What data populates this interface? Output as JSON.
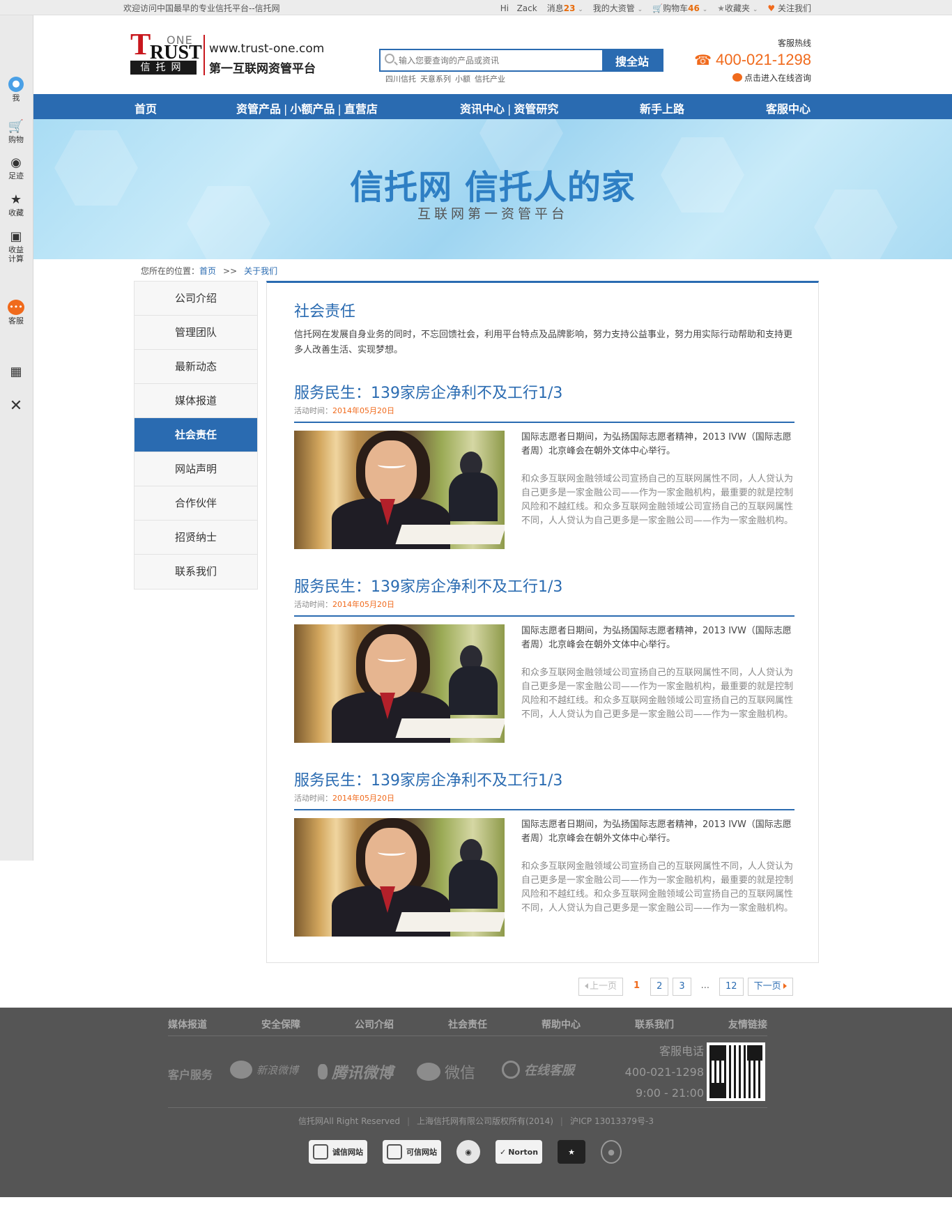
{
  "topbar": {
    "welcome": "欢迎访问中国最早的专业信托平台--信托网",
    "hi": "Hi",
    "user": "Zack",
    "messages_label": "消息",
    "messages_count": "23",
    "my_assets": "我的大资管",
    "cart_label": "购物车",
    "cart_count": "46",
    "favorites": "收藏夹",
    "follow": "关注我们"
  },
  "sidebar": {
    "me": "我",
    "shopping": "购物",
    "footprint": "足迹",
    "collect": "收藏",
    "calc": "收益计算",
    "service": "客服"
  },
  "header": {
    "logo_one": "ONE",
    "logo_trust": "RUST",
    "logo_t": "T",
    "logo_cn": "信托网",
    "url": "www.trust-one.com",
    "slogan": "第一互联网资管平台",
    "search_placeholder": "输入您要查询的产品或资讯",
    "search_button": "搜全站",
    "hotwords": [
      "四川信托",
      "天意系列",
      "小额",
      "信托产业"
    ],
    "hotline_label": "客服热线",
    "hotline_number": "400-021-1298",
    "online_consult": "点击进入在线咨询"
  },
  "nav": {
    "home": "首页",
    "asset_products": "资管产品",
    "small_products": "小额产品",
    "direct_store": "直营店",
    "news_center": "资讯中心",
    "asset_research": "资管研究",
    "newbie": "新手上路",
    "service_center": "客服中心"
  },
  "banner": {
    "title": "信托网 信托人的家",
    "subtitle": "互联网第一资管平台"
  },
  "breadcrumb": {
    "label": "您所在的位置：",
    "home": "首页",
    "arrow": ">>",
    "current": "关于我们"
  },
  "menu": [
    {
      "label": "公司介绍"
    },
    {
      "label": "管理团队"
    },
    {
      "label": "最新动态"
    },
    {
      "label": "媒体报道"
    },
    {
      "label": "社会责任"
    },
    {
      "label": "网站声明"
    },
    {
      "label": "合作伙伴"
    },
    {
      "label": "招贤纳士"
    },
    {
      "label": "联系我们"
    }
  ],
  "content": {
    "title": "社会责任",
    "intro": "信托网在发展自身业务的同时，不忘回馈社会，利用平台特点及品牌影响，努力支持公益事业，努力用实际行动帮助和支持更多人改善生活、实现梦想。",
    "articles": [
      {
        "title": "服务民生：139家房企净利不及工行1/3",
        "date_label": "活动时间：",
        "date": "2014年05月20日",
        "para1": "国际志愿者日期间，为弘扬国际志愿者精神，2013 IVW（国际志愿者周）北京峰会在朝外文体中心举行。",
        "para2": "和众多互联网金融领域公司宣扬自己的互联网属性不同，人人贷认为自己更多是一家金融公司——作为一家金融机构，最重要的就是控制风险和不越红线。和众多互联网金融领域公司宣扬自己的互联网属性不同，人人贷认为自己更多是一家金融公司——作为一家金融机构。"
      },
      {
        "title": "服务民生：139家房企净利不及工行1/3",
        "date_label": "活动时间：",
        "date": "2014年05月20日",
        "para1": "国际志愿者日期间，为弘扬国际志愿者精神，2013 IVW（国际志愿者周）北京峰会在朝外文体中心举行。",
        "para2": "和众多互联网金融领域公司宣扬自己的互联网属性不同，人人贷认为自己更多是一家金融公司——作为一家金融机构，最重要的就是控制风险和不越红线。和众多互联网金融领域公司宣扬自己的互联网属性不同，人人贷认为自己更多是一家金融公司——作为一家金融机构。"
      },
      {
        "title": "服务民生：139家房企净利不及工行1/3",
        "date_label": "活动时间：",
        "date": "2014年05月20日",
        "para1": "国际志愿者日期间，为弘扬国际志愿者精神，2013 IVW（国际志愿者周）北京峰会在朝外文体中心举行。",
        "para2": "和众多互联网金融领域公司宣扬自己的互联网属性不同，人人贷认为自己更多是一家金融公司——作为一家金融机构，最重要的就是控制风险和不越红线。和众多互联网金融领域公司宣扬自己的互联网属性不同，人人贷认为自己更多是一家金融公司——作为一家金融机构。"
      }
    ]
  },
  "pager": {
    "prev": "上一页",
    "p1": "1",
    "p2": "2",
    "p3": "3",
    "dots": "...",
    "last": "12",
    "next": "下一页"
  },
  "footer": {
    "nav": [
      "媒体报道",
      "安全保障",
      "公司介绍",
      "社会责任",
      "帮助中心",
      "联系我们",
      "友情链接"
    ],
    "service": "客户服务",
    "weibo": "新浪微博",
    "tencent": "腾讯微博",
    "wechat": "微信",
    "online": "在线客服",
    "phone_label": "客服电话",
    "phone": "400-021-1298",
    "hours": "9:00 - 21:00",
    "copy1": "信托网All Right Reserved",
    "copy2": "上海信托网有限公司版权所有(2014)",
    "copy3": "沪ICP 13013379号-3",
    "badge1": "诚信网站",
    "badge2": "可信网站",
    "badge_norton": "Norton"
  },
  "colors": {
    "primary": "#2a6bb1",
    "accent": "#f06a1c",
    "footer_bg": "#555555"
  }
}
